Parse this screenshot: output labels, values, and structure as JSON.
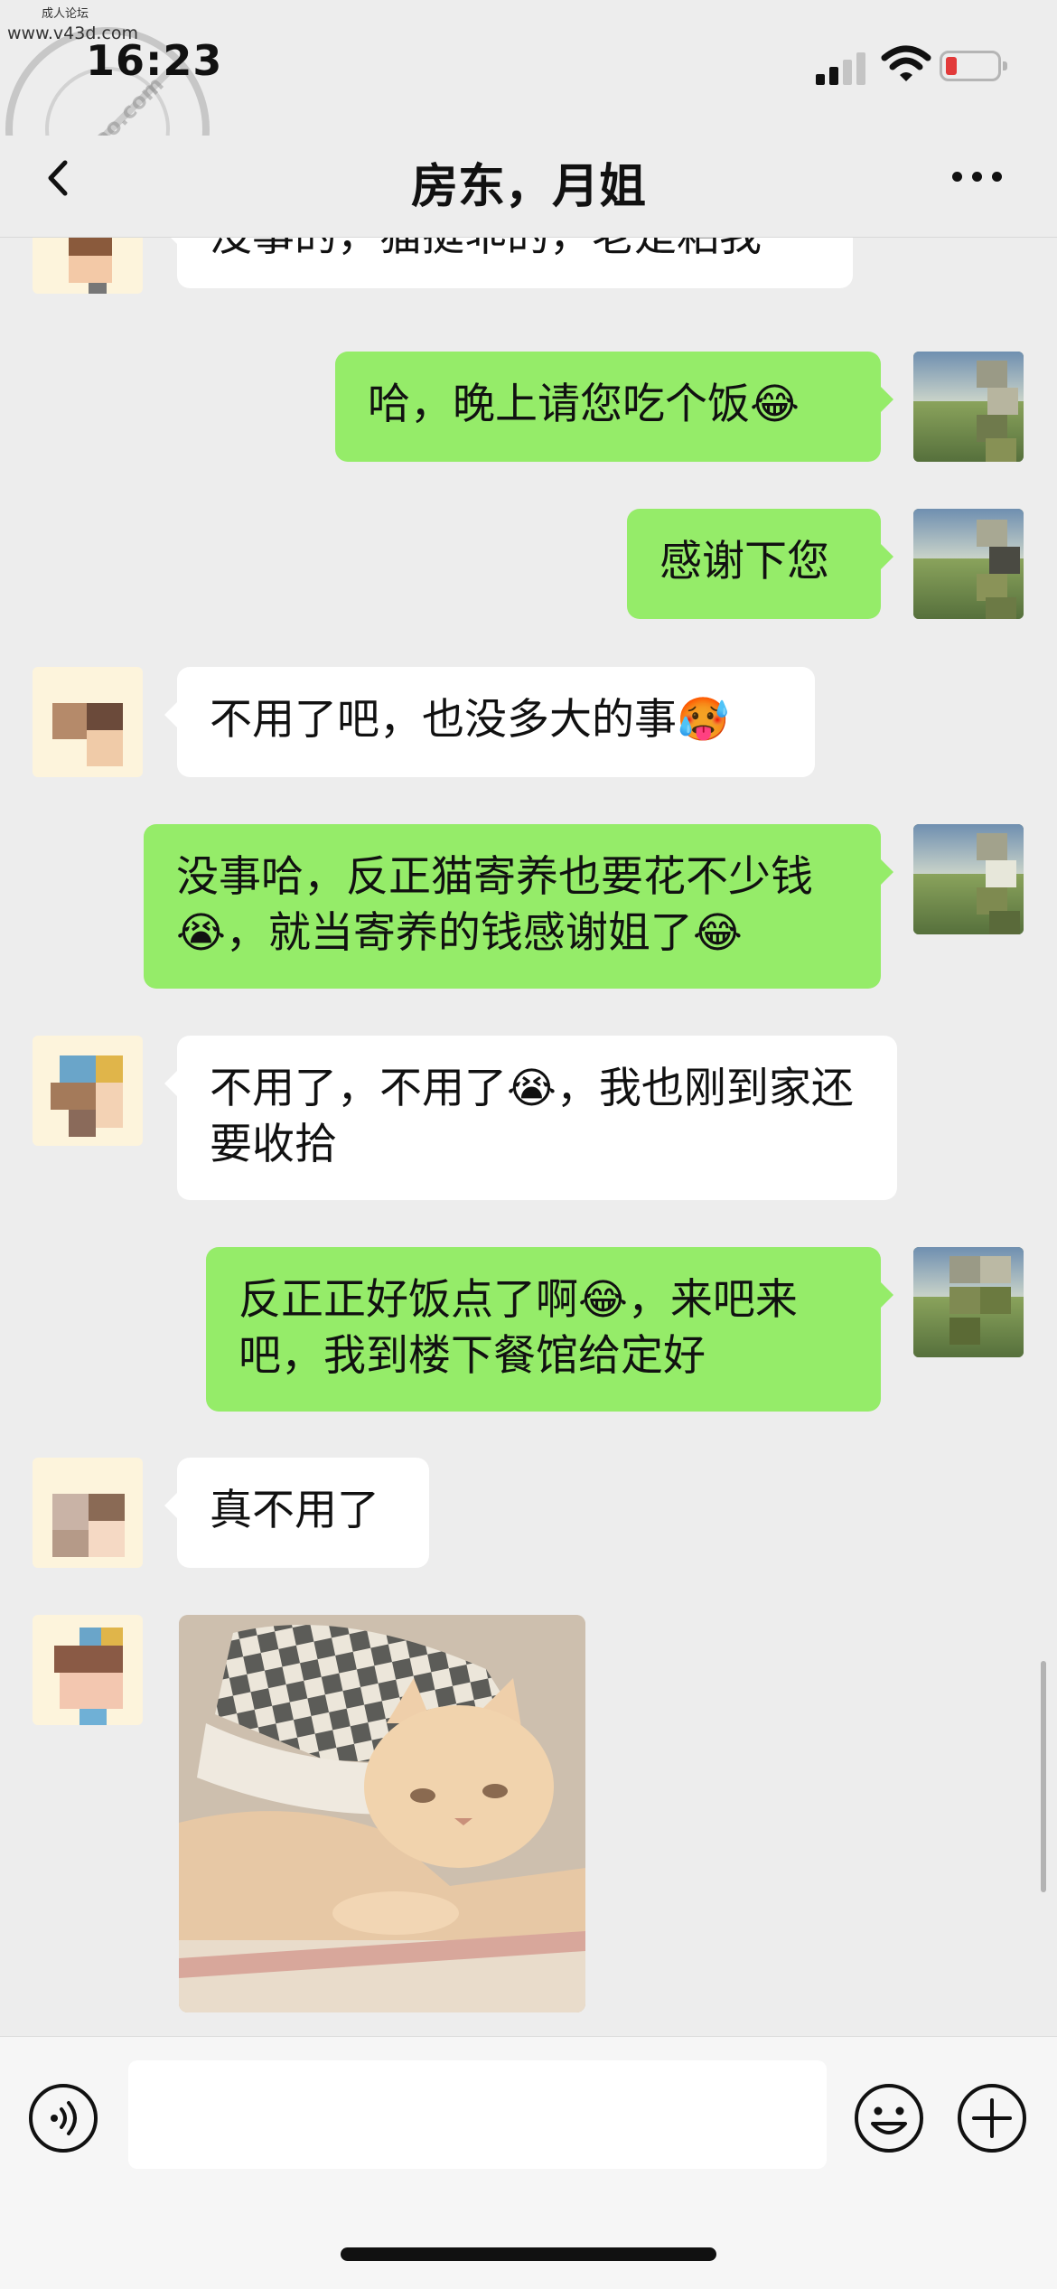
{
  "watermark": {
    "top_label": "成人论坛",
    "url": "www.v43d.com",
    "seal_text": "haijiao.com"
  },
  "status_bar": {
    "time": "16:23"
  },
  "nav": {
    "title": "房东，月姐"
  },
  "messages": [
    {
      "side": "left",
      "text": "没事的，猫挺乖的，老是粘我"
    },
    {
      "side": "right",
      "text": "哈，晚上请您吃个饭😂"
    },
    {
      "side": "right",
      "text": "感谢下您"
    },
    {
      "side": "left",
      "text": "不用了吧，也没多大的事🥵"
    },
    {
      "side": "right",
      "text": "没事哈，反正猫寄养也要花不少钱😭，就当寄养的钱感谢姐了😂"
    },
    {
      "side": "left",
      "text": "不用了，不用了😭，我也刚到家还要收拾"
    },
    {
      "side": "right",
      "text": "反正正好饭点了啊😂，来吧来吧，我到楼下餐馆给定好"
    },
    {
      "side": "left",
      "text": "真不用了"
    },
    {
      "side": "left",
      "type": "image",
      "icon": "cat-sticker"
    }
  ],
  "input_bar": {
    "placeholder": "",
    "value": ""
  },
  "colors": {
    "background": "#ededed",
    "bubble_self": "#95ec69",
    "bubble_other": "#ffffff"
  }
}
